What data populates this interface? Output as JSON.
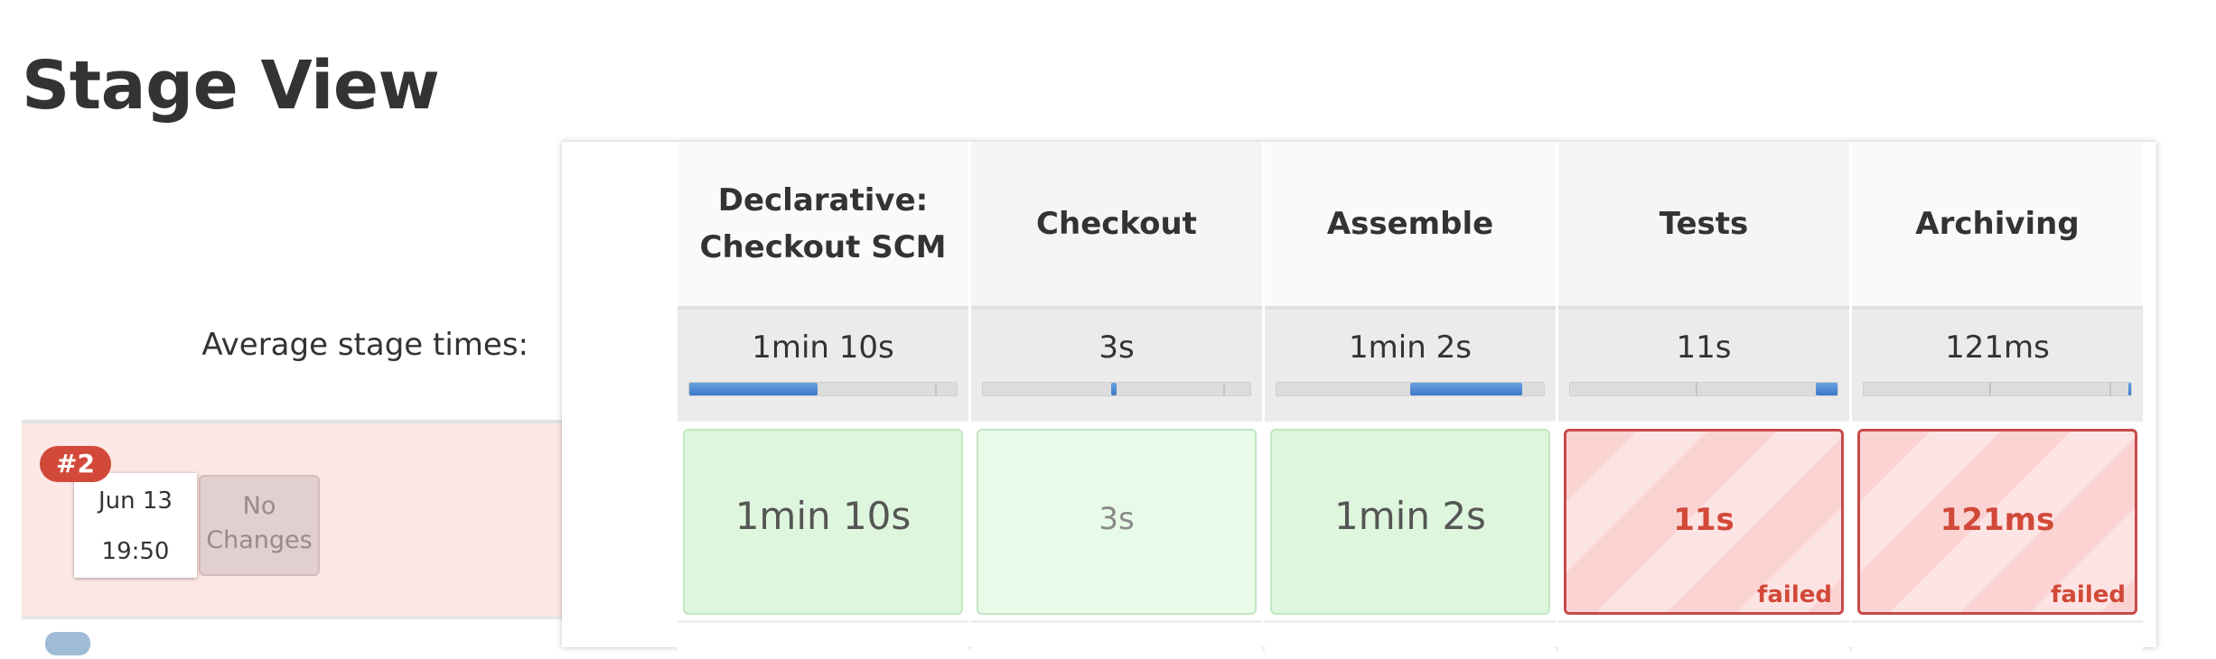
{
  "page": {
    "title": "Stage View"
  },
  "average_label": "Average stage times:",
  "build": {
    "number": "#2",
    "date": "Jun 13",
    "time": "19:50",
    "changes": "No Changes"
  },
  "stages": [
    {
      "name": "Declarative: Checkout SCM",
      "avg": "1min 10s",
      "avg_bar_fraction": 0.48,
      "run": "1min 10s",
      "status": "success"
    },
    {
      "name": "Checkout",
      "avg": "3s",
      "avg_bar_fraction": 0.02,
      "run": "3s",
      "status": "success"
    },
    {
      "name": "Assemble",
      "avg": "1min 2s",
      "avg_bar_fraction": 0.43,
      "run": "1min 2s",
      "status": "success"
    },
    {
      "name": "Tests",
      "avg": "11s",
      "avg_bar_fraction": 0.08,
      "run": "11s",
      "status": "failed",
      "status_label": "failed"
    },
    {
      "name": "Archiving",
      "avg": "121ms",
      "avg_bar_fraction": 0.01,
      "run": "121ms",
      "status": "failed",
      "status_label": "failed"
    }
  ],
  "colors": {
    "success_bg": "#ddf6dd",
    "failed_border": "#c84a4a",
    "failed_text": "#d24939",
    "badge_bg": "#d24939",
    "bar_fill": "#3b78c9"
  }
}
